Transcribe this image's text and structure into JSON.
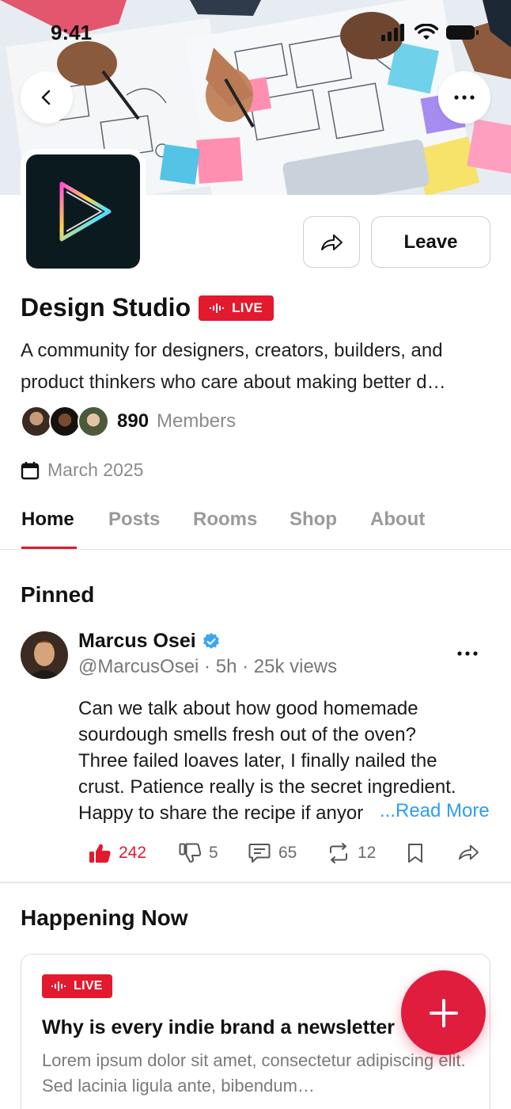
{
  "status_bar": {
    "time": "9:41"
  },
  "community": {
    "name": "Design Studio",
    "live_label": "LIVE",
    "description": "A community for designers, creators, builders, and product thinkers who care about making better d…",
    "member_count": "890",
    "member_label": "Members",
    "created": "March 2025",
    "leave_label": "Leave"
  },
  "tabs": [
    {
      "label": "Home",
      "active": true
    },
    {
      "label": "Posts",
      "active": false
    },
    {
      "label": "Rooms",
      "active": false
    },
    {
      "label": "Shop",
      "active": false
    },
    {
      "label": "About",
      "active": false
    }
  ],
  "pinned": {
    "section_title": "Pinned",
    "author": "Marcus Osei",
    "meta": "@MarcusOsei · 5h · 25k views",
    "lines": [
      "Can we talk about how good homemade",
      "sourdough smells fresh out of the oven?",
      "Three failed loaves later, I finally nailed the",
      "crust. Patience really is the secret ingredient.",
      "Happy to share the recipe if anyor"
    ],
    "read_more": "...Read More",
    "likes": "242",
    "dislikes": "5",
    "comments": "65",
    "reposts": "12"
  },
  "happening": {
    "section_title": "Happening Now",
    "live_label": "LIVE",
    "title": "Why is every indie brand a newsletter",
    "description": "Lorem ipsum dolor sit amet, consectetur adipiscing elit. Sed lacinia ligula ante, bibendum…"
  },
  "colors": {
    "accent": "#e3192e",
    "link": "#2b9df4",
    "fab": "#e11d3e"
  }
}
